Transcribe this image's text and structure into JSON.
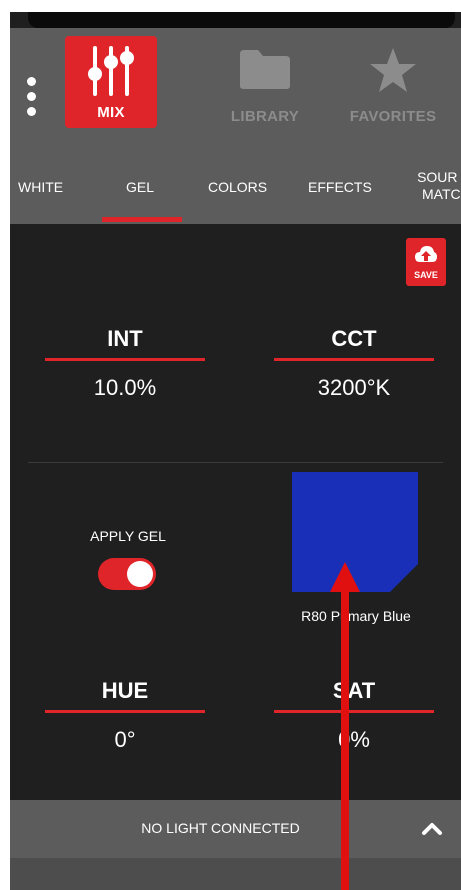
{
  "mode_tabs": [
    {
      "label": "MIX",
      "icon": "sliders-icon",
      "active": true
    },
    {
      "label": "LIBRARY",
      "icon": "folder-icon",
      "active": false
    },
    {
      "label": "FAVORITES",
      "icon": "star-icon",
      "active": false
    }
  ],
  "sub_tabs": [
    {
      "label": "WHITE"
    },
    {
      "label": "GEL",
      "active": true
    },
    {
      "label": "COLORS"
    },
    {
      "label": "EFFECTS"
    },
    {
      "line1": "SOUR",
      "line2": "MATC"
    }
  ],
  "save": {
    "label": "SAVE",
    "icon": "cloud-upload-icon"
  },
  "params": {
    "int": {
      "title": "INT",
      "value": "10.0%"
    },
    "cct": {
      "title": "CCT",
      "value": "3200°K"
    },
    "hue": {
      "title": "HUE",
      "value": "0°"
    },
    "sat": {
      "title": "SAT",
      "value": "0%"
    }
  },
  "gel": {
    "apply_label": "APPLY GEL",
    "apply_on": true,
    "name": "R80 Primary Blue",
    "swatch_color": "#1a2fb8"
  },
  "status": {
    "text": "NO LIGHT CONNECTED",
    "icon": "chevron-up-icon"
  },
  "colors": {
    "accent": "#e0252a",
    "panel": "#5c5c5c",
    "background": "#1f1f1f"
  },
  "annotation": {
    "icon": "red-arrow-icon",
    "color": "#e01010"
  }
}
